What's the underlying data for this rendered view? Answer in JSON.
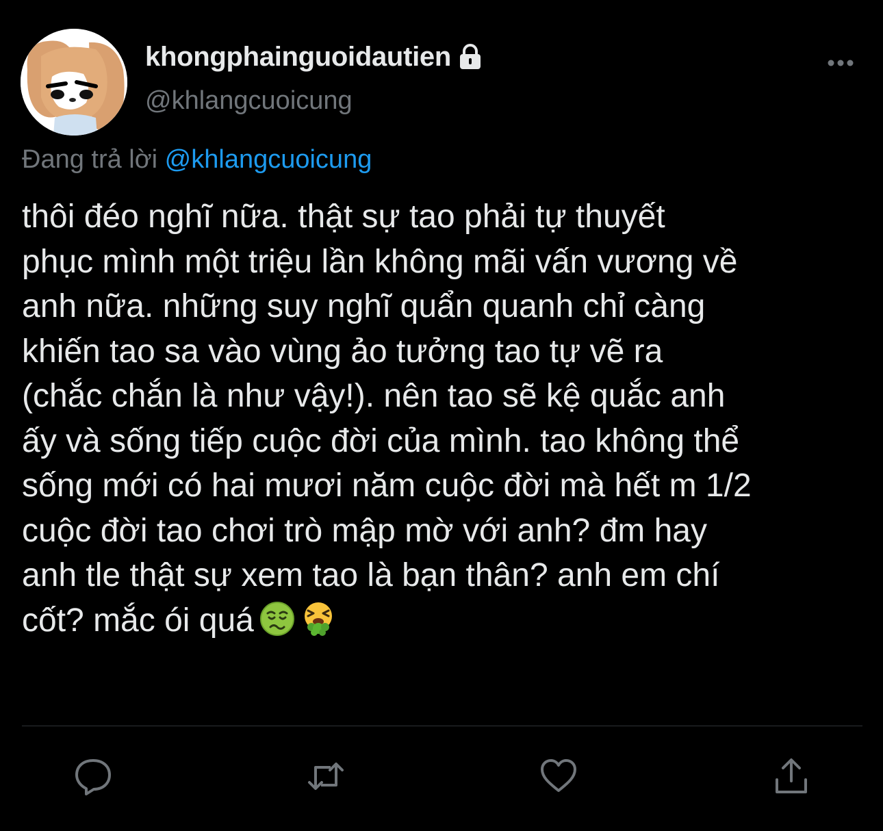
{
  "tweet": {
    "author": {
      "display_name": "khongphainguoidautien",
      "handle": "@khlangcuoicung",
      "protected": true
    },
    "reply_context": {
      "prefix": "Đang trả lời",
      "mention": "@khlangcuoicung"
    },
    "text_lines": [
      "thôi đéo nghĩ nữa. thật sự tao phải tự thuyết",
      "phục mình một triệu lần không mãi vấn vương về",
      "anh nữa. những suy nghĩ quẩn quanh chỉ càng",
      "khiến tao sa vào vùng ảo tưởng tao tự vẽ ra",
      "(chắc chắn là như vậy!). nên tao sẽ kệ quắc anh",
      "ấy và sống tiếp cuộc đời của mình. tao không thể",
      "sống mới có hai mươi năm cuộc đời mà hết m 1/2",
      "cuộc đời tao chơi trò mập mờ với anh? đm hay",
      "anh tle thật sự xem tao là bạn thân? anh em chí",
      "cốt? mắc ói quá"
    ],
    "emojis": [
      "nauseated-face",
      "face-vomiting"
    ],
    "actions": [
      "reply",
      "retweet",
      "like",
      "share"
    ]
  },
  "colors": {
    "background": "#000000",
    "text_primary": "#e7e9ea",
    "text_secondary": "#71767b",
    "accent": "#1d9bf0",
    "divider": "#2f3336"
  }
}
